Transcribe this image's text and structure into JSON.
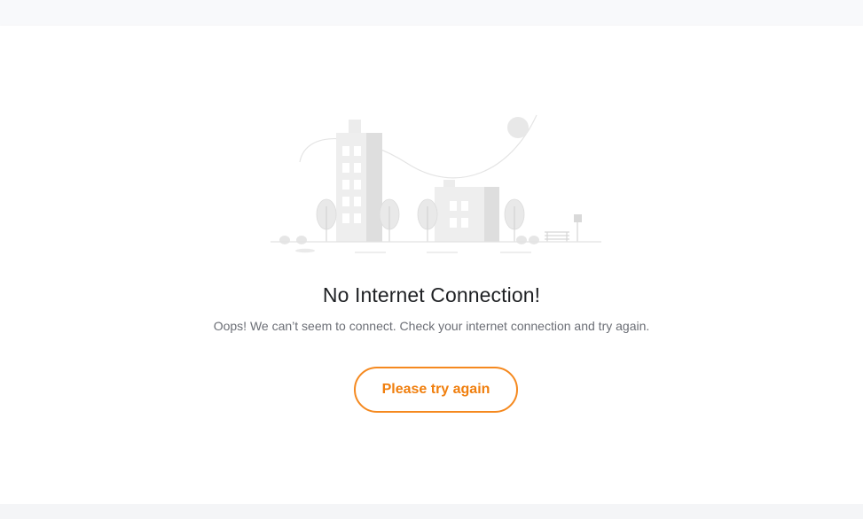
{
  "page": {
    "illustration_icon": "offline-city-illustration",
    "title": "No Internet Connection!",
    "message": "Oops! We can’t seem to connect. Check your internet connection and try again.",
    "retry_label": "Please try again"
  },
  "colors": {
    "accent": "#f5891f",
    "title": "#1f2124",
    "message": "#6b6e75",
    "illustration": "#e6e6e6"
  }
}
